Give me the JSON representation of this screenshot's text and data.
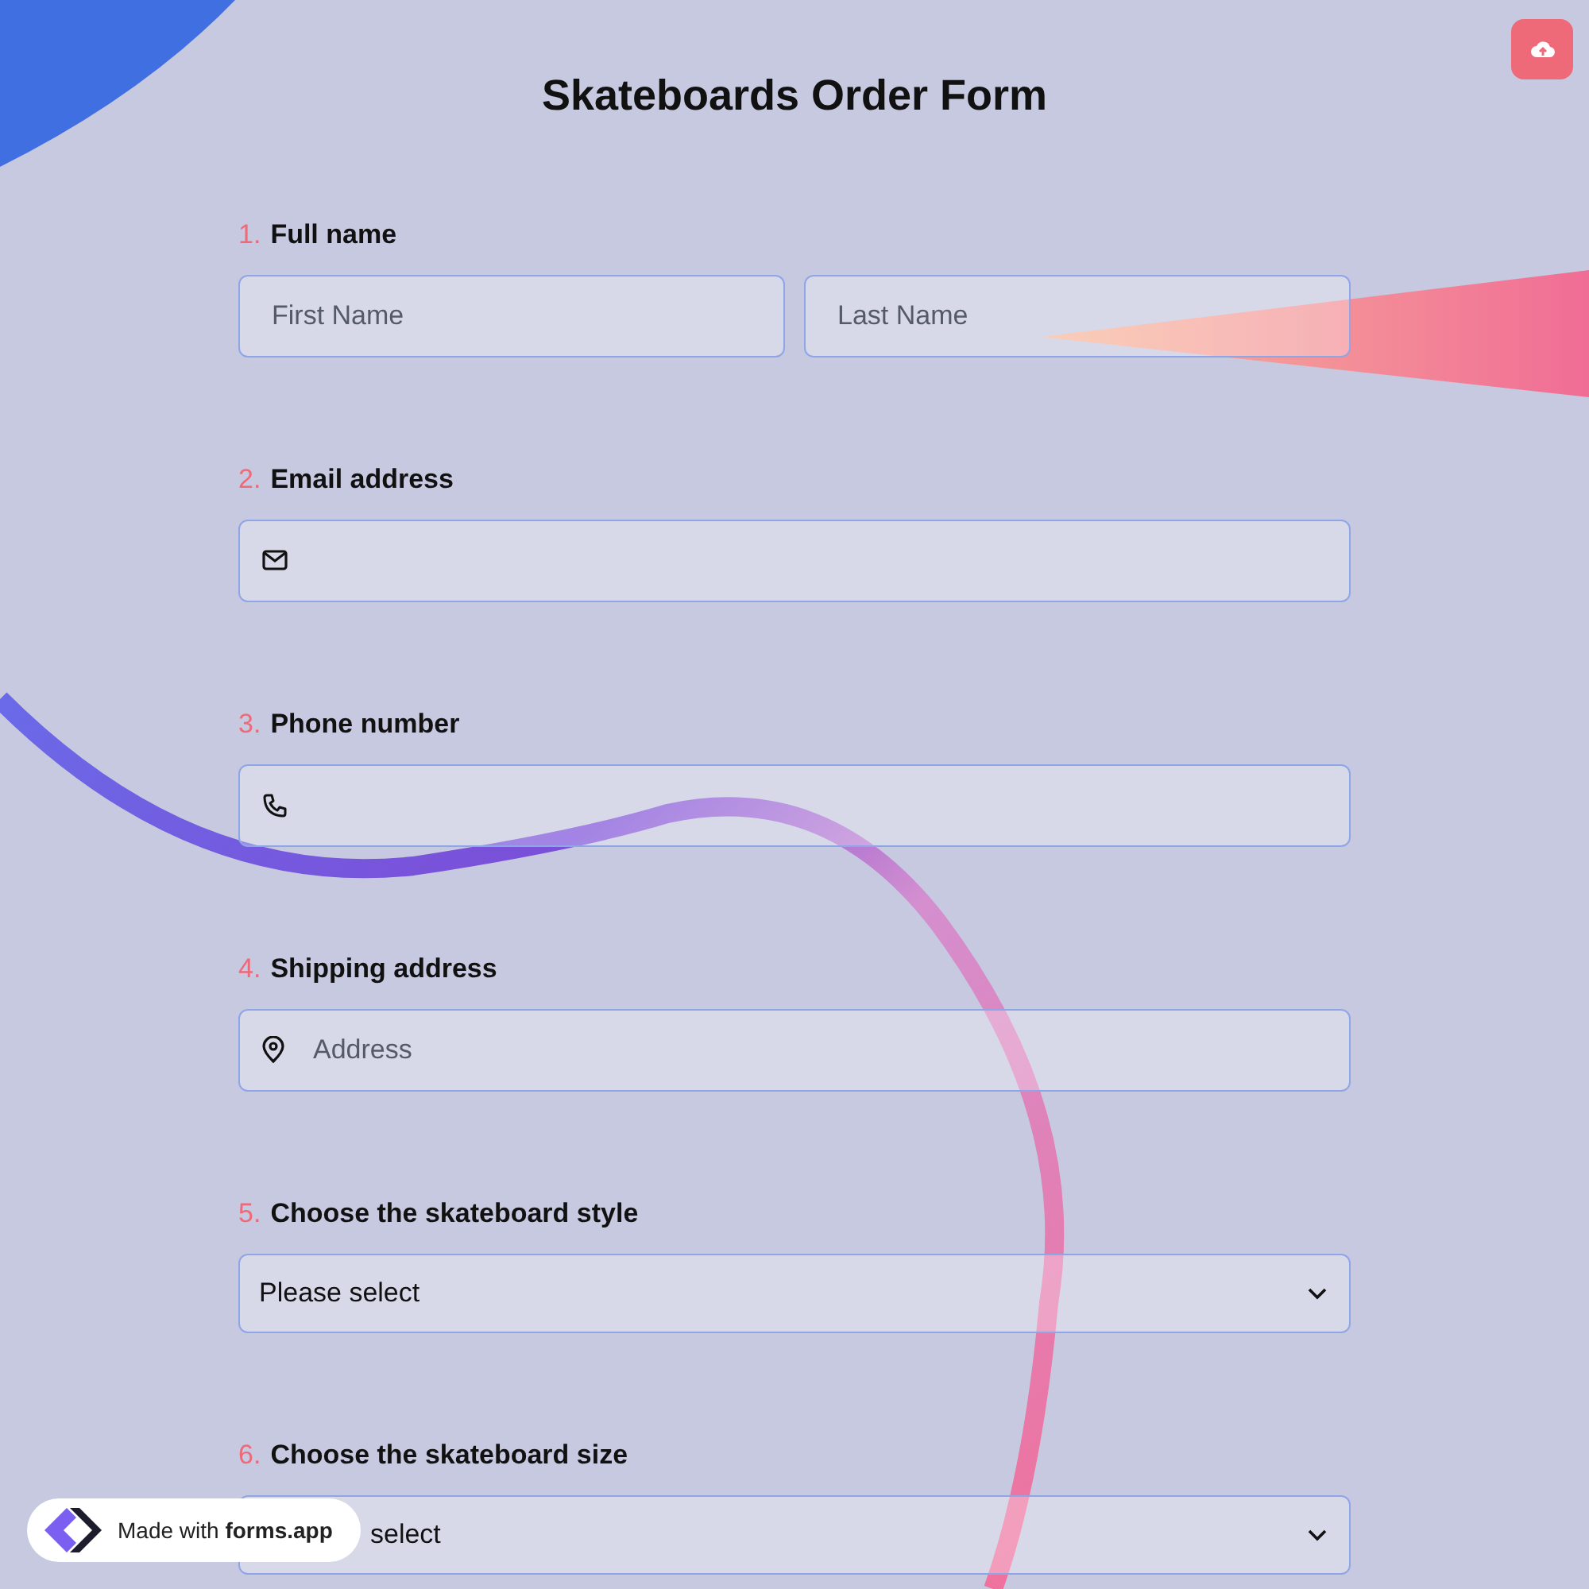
{
  "title": "Skateboards Order Form",
  "questions": [
    {
      "number": "1.",
      "label": "Full name",
      "kind": "name",
      "fields": [
        {
          "placeholder": "First Name"
        },
        {
          "placeholder": "Last Name"
        }
      ]
    },
    {
      "number": "2.",
      "label": "Email address",
      "kind": "email"
    },
    {
      "number": "3.",
      "label": "Phone number",
      "kind": "phone"
    },
    {
      "number": "4.",
      "label": "Shipping address",
      "kind": "address",
      "placeholder": "Address"
    },
    {
      "number": "5.",
      "label": "Choose the skateboard style",
      "kind": "select",
      "value": "Please select",
      "covered": false
    },
    {
      "number": "6.",
      "label": "Choose the skateboard size",
      "kind": "select",
      "value": "select",
      "covered": true
    }
  ],
  "badge": {
    "text": "Made with **forms.app**"
  }
}
